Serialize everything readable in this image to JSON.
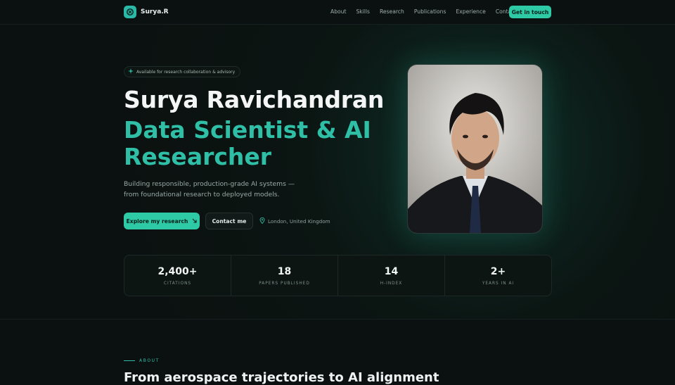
{
  "nav": {
    "logo_text": "Surya.R",
    "links": [
      "About",
      "Skills",
      "Research",
      "Publications",
      "Experience",
      "Contact"
    ],
    "cta_label": "Get in touch"
  },
  "hero": {
    "badge": "Available for research collaboration & advisory",
    "name": "Surya Ravichandran",
    "role": "Data Scientist & AI Researcher",
    "lead": "Building responsible, production-grade AI systems — from foundational research to deployed models.",
    "primary_button": "Explore my research",
    "secondary_button": "Contact me",
    "location": "London, United Kingdom"
  },
  "stats": [
    {
      "value": "2,400+",
      "label": "CITATIONS"
    },
    {
      "value": "18",
      "label": "PAPERS PUBLISHED"
    },
    {
      "value": "14",
      "label": "H-INDEX"
    },
    {
      "value": "2+",
      "label": "YEARS IN AI"
    }
  ],
  "about": {
    "label": "ABOUT",
    "title": "From aerospace trajectories to AI alignment"
  },
  "colors": {
    "accent": "#2ec9a5",
    "background": "#0b1110"
  }
}
